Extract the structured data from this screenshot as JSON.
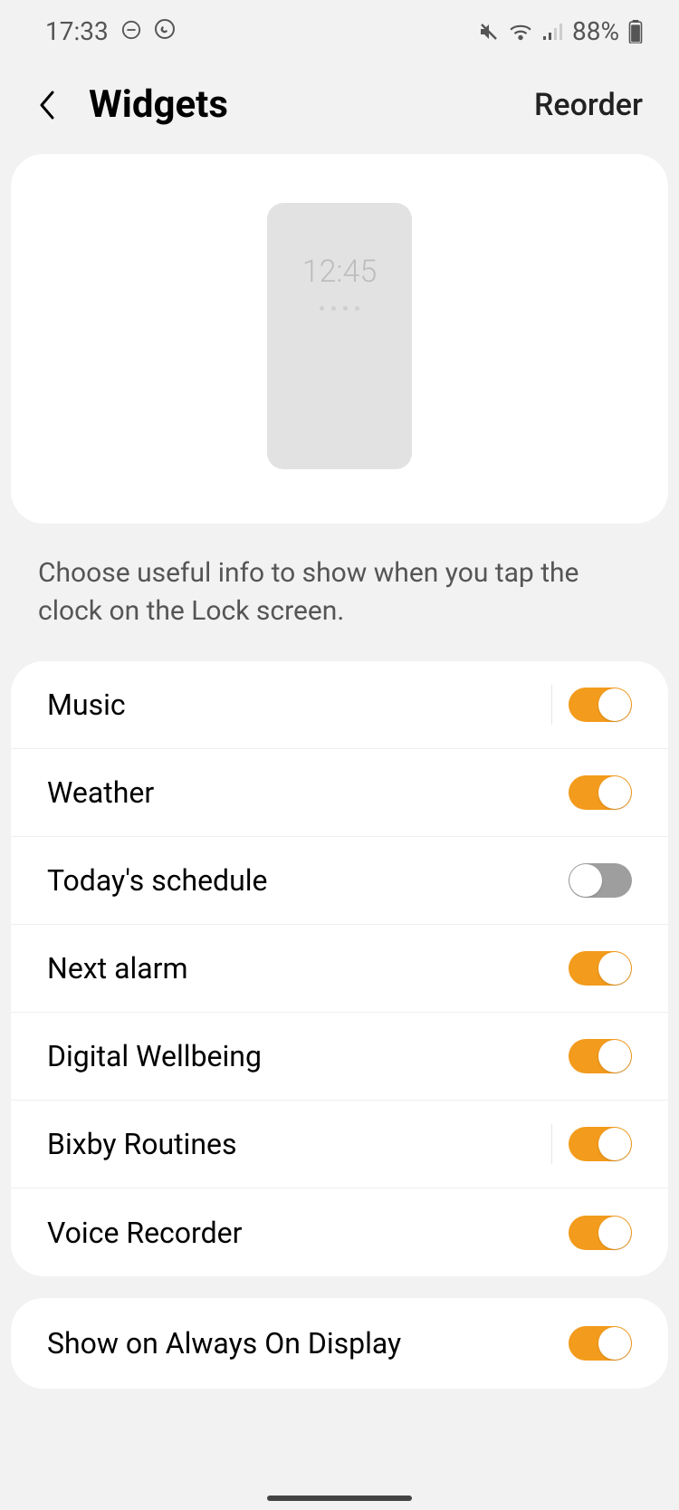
{
  "status": {
    "time": "17:33",
    "battery_pct": "88%"
  },
  "header": {
    "title": "Widgets",
    "reorder_label": "Reorder"
  },
  "preview": {
    "mock_time": "12:45"
  },
  "description": "Choose useful info to show when you tap the clock on the Lock screen.",
  "widgets": [
    {
      "label": "Music",
      "on": true,
      "divider": true
    },
    {
      "label": "Weather",
      "on": true,
      "divider": false
    },
    {
      "label": "Today's schedule",
      "on": false,
      "divider": false
    },
    {
      "label": "Next alarm",
      "on": true,
      "divider": false
    },
    {
      "label": "Digital Wellbeing",
      "on": true,
      "divider": false
    },
    {
      "label": "Bixby Routines",
      "on": true,
      "divider": true
    },
    {
      "label": "Voice Recorder",
      "on": true,
      "divider": false
    }
  ],
  "aod": {
    "label": "Show on Always On Display",
    "on": true
  }
}
